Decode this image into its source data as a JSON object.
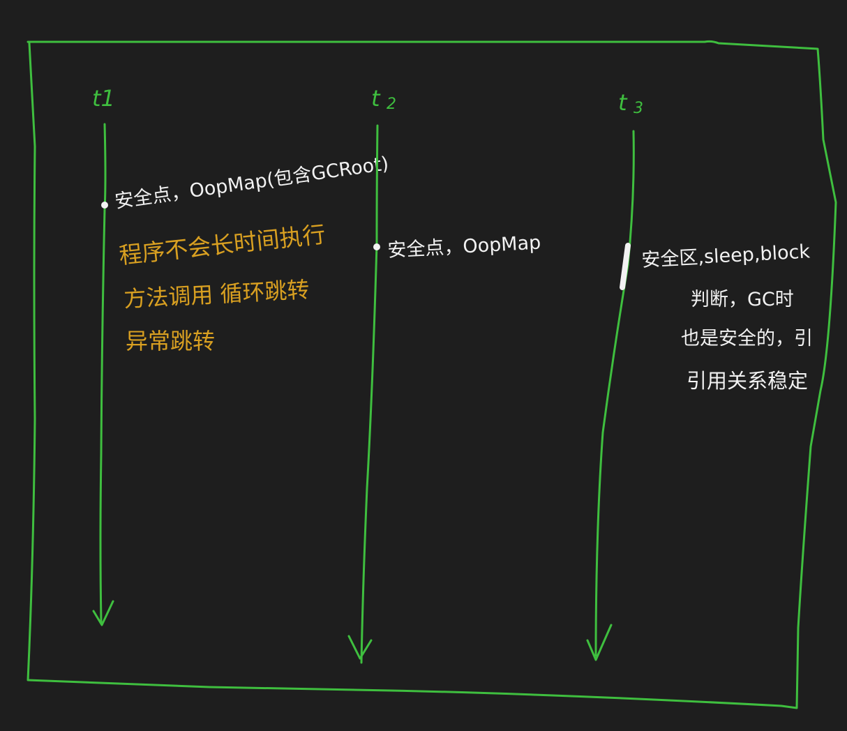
{
  "colors": {
    "background": "#1e1e1e",
    "frame": "#3fbf3f",
    "note_white": "#f2f2f2",
    "note_orange": "#d9a021"
  },
  "timelines": [
    {
      "label": "t1",
      "notes": [
        "安全点，OopMap(包含GCRoot)"
      ]
    },
    {
      "label": "t2",
      "notes": [
        "安全点，OopMap"
      ]
    },
    {
      "label": "t3",
      "notes": [
        "安全区,sleep,block",
        "判断，GC时",
        "引用关系稳定"
      ]
    }
  ],
  "annotation_orange": [
    "程序不会长时间执行",
    "方法调用 循环跳转",
    "异常跳转"
  ]
}
